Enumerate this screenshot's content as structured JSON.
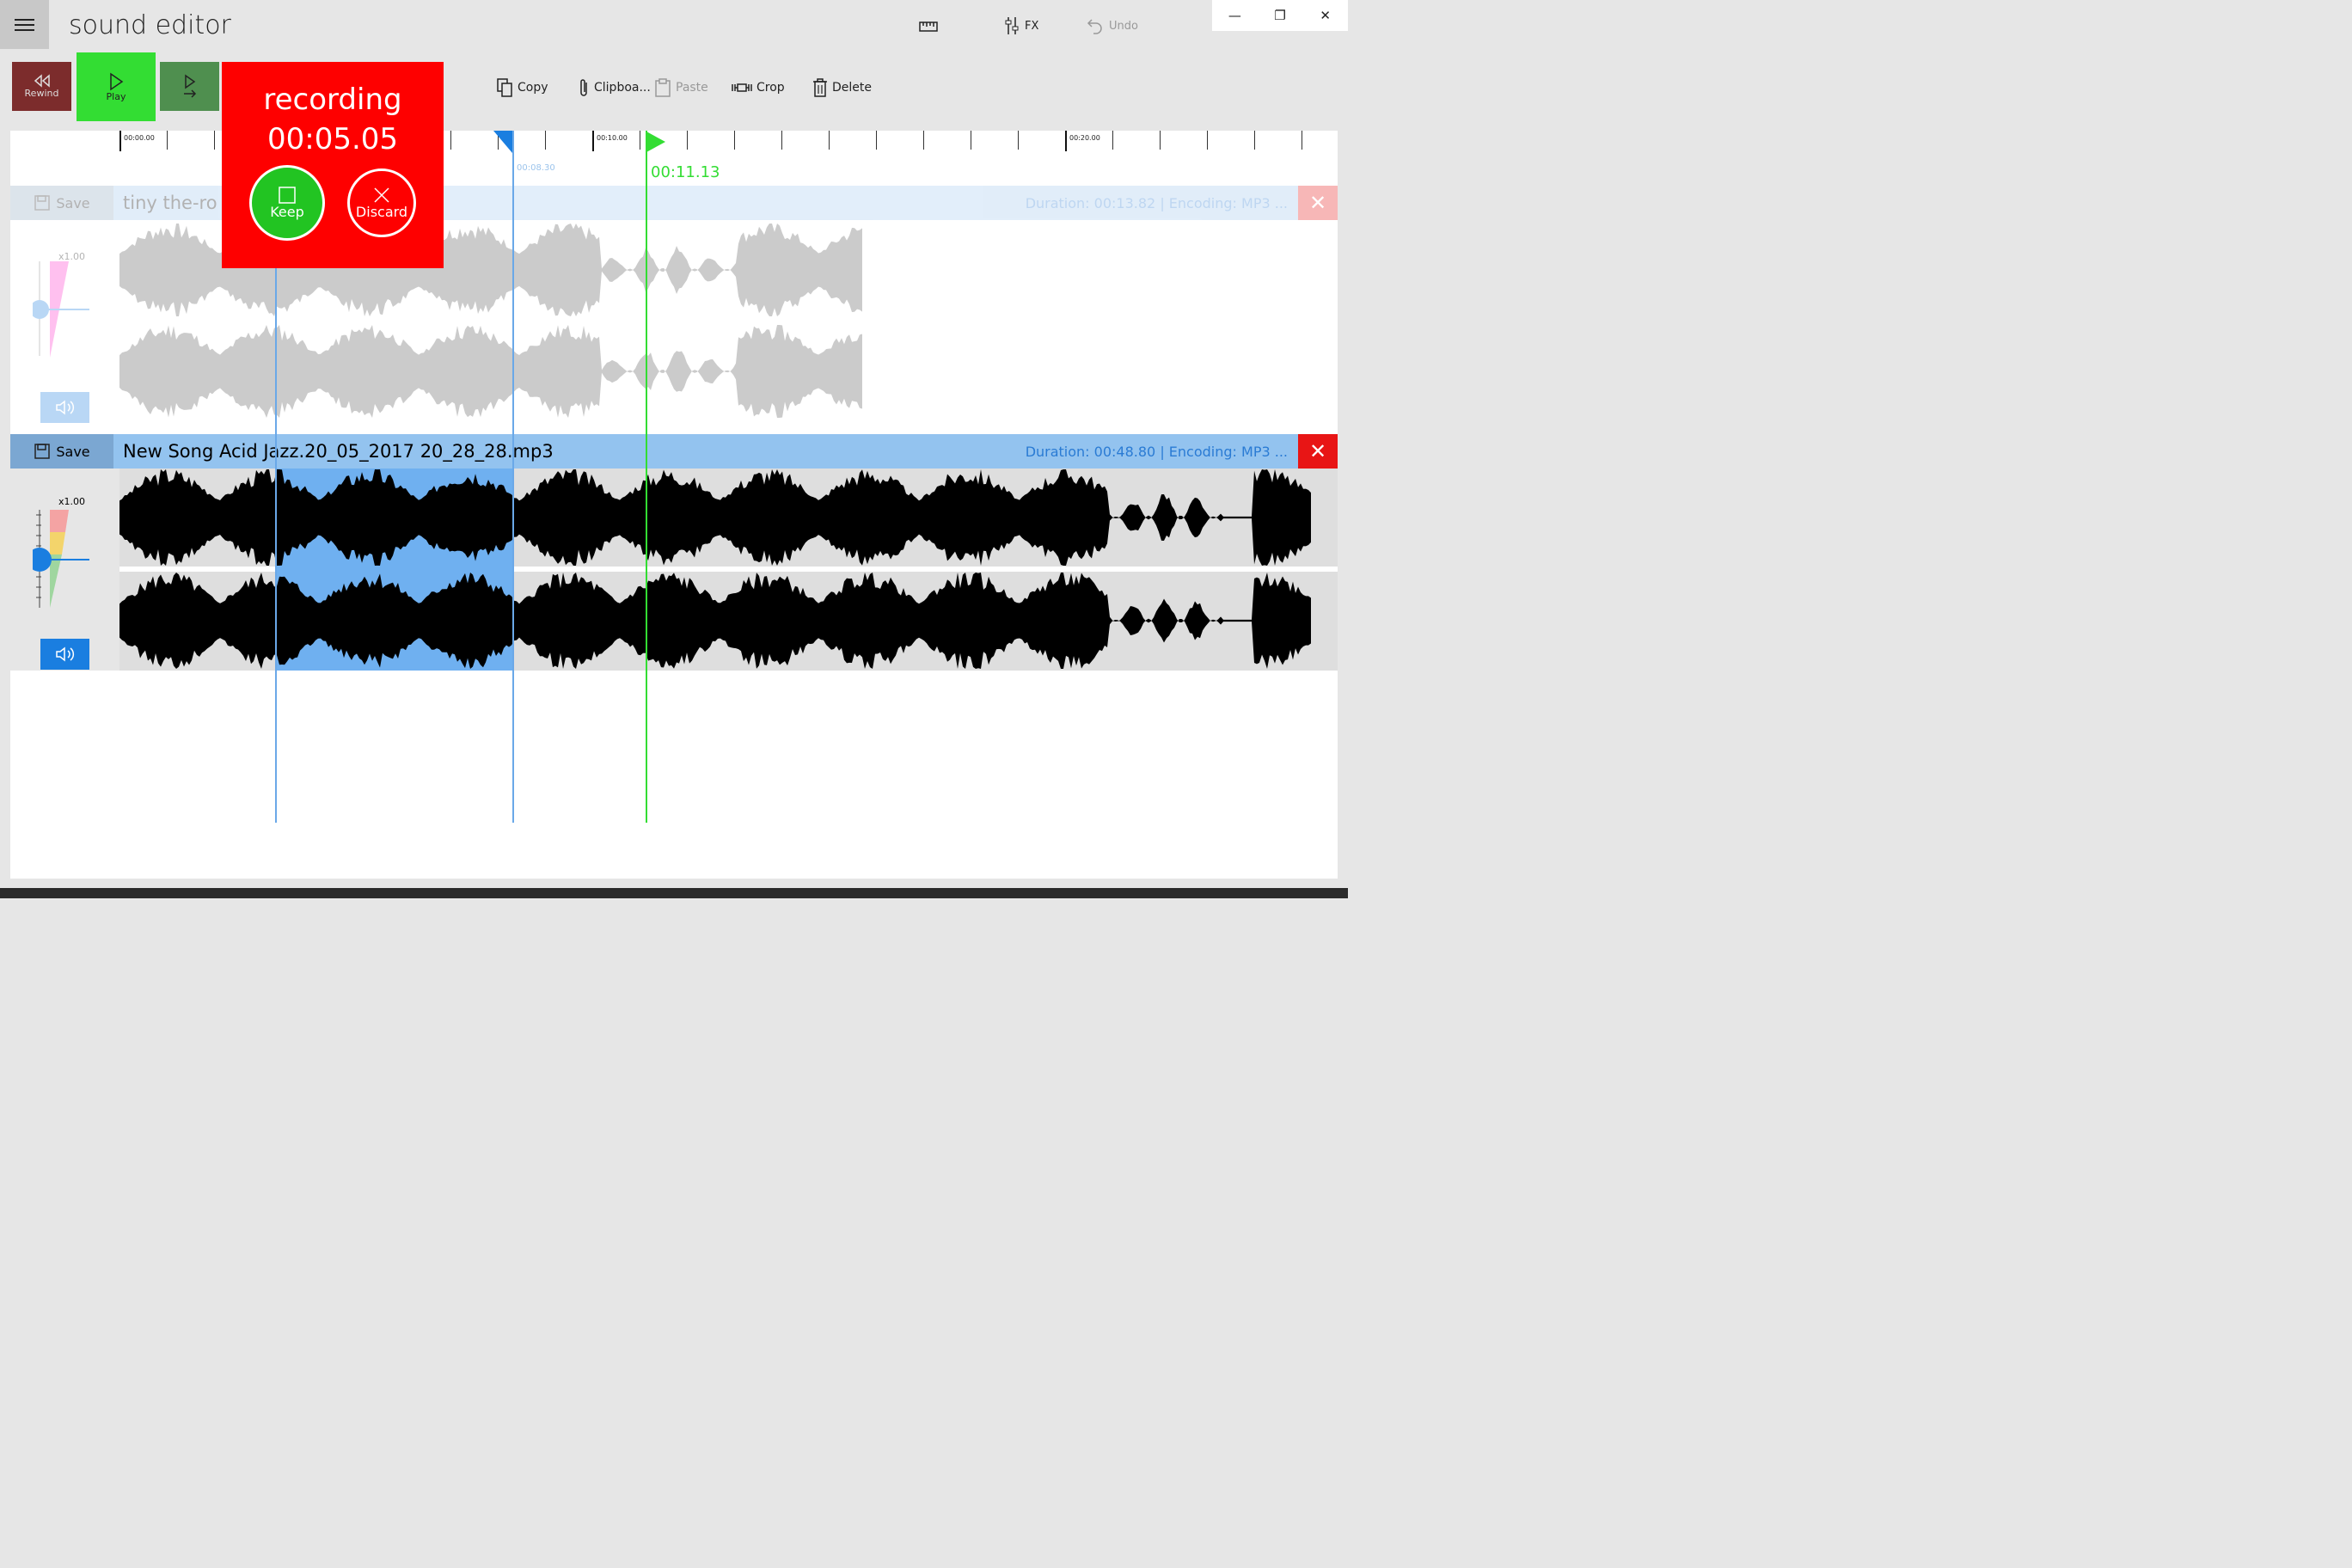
{
  "app": {
    "title": "sound editor"
  },
  "top_toolbar": {
    "fx_label": "FX",
    "undo_label": "Undo"
  },
  "window_controls": {
    "minimize": "—",
    "restore": "❐",
    "close": "✕"
  },
  "transport": {
    "rewind_label": "Rewind",
    "play_label": "Play"
  },
  "edit_toolbar": {
    "copy": "Copy",
    "clipboard": "Clipboa...",
    "paste": "Paste",
    "crop": "Crop",
    "delete": "Delete"
  },
  "timeline": {
    "ticks": [
      "00:00.00",
      "00:10.00",
      "00:20.00"
    ],
    "selection_end_label": "00:08.30",
    "playhead_label": "00:11.13"
  },
  "recording": {
    "label": "recording",
    "time": "00:05.05",
    "keep": "Keep",
    "discard": "Discard"
  },
  "tracks": [
    {
      "save_label": "Save",
      "name": "tiny the-ro",
      "duration_label": "Duration:",
      "duration": "00:13.82",
      "encoding_label": "Encoding:",
      "encoding": "MP3 ...",
      "speed": "x1.00"
    },
    {
      "save_label": "Save",
      "name": "New Song Acid Jazz.20_05_2017 20_28_28.mp3",
      "duration_label": "Duration:",
      "duration": "00:48.80",
      "encoding_label": "Encoding:",
      "encoding": "MP3 ...",
      "speed": "x1.00"
    }
  ],
  "colors": {
    "accent": "#1a7ee0",
    "recording": "#fe0000",
    "keep": "#22c422",
    "playhead": "#33dd33",
    "selection": "#6fb0f0"
  }
}
